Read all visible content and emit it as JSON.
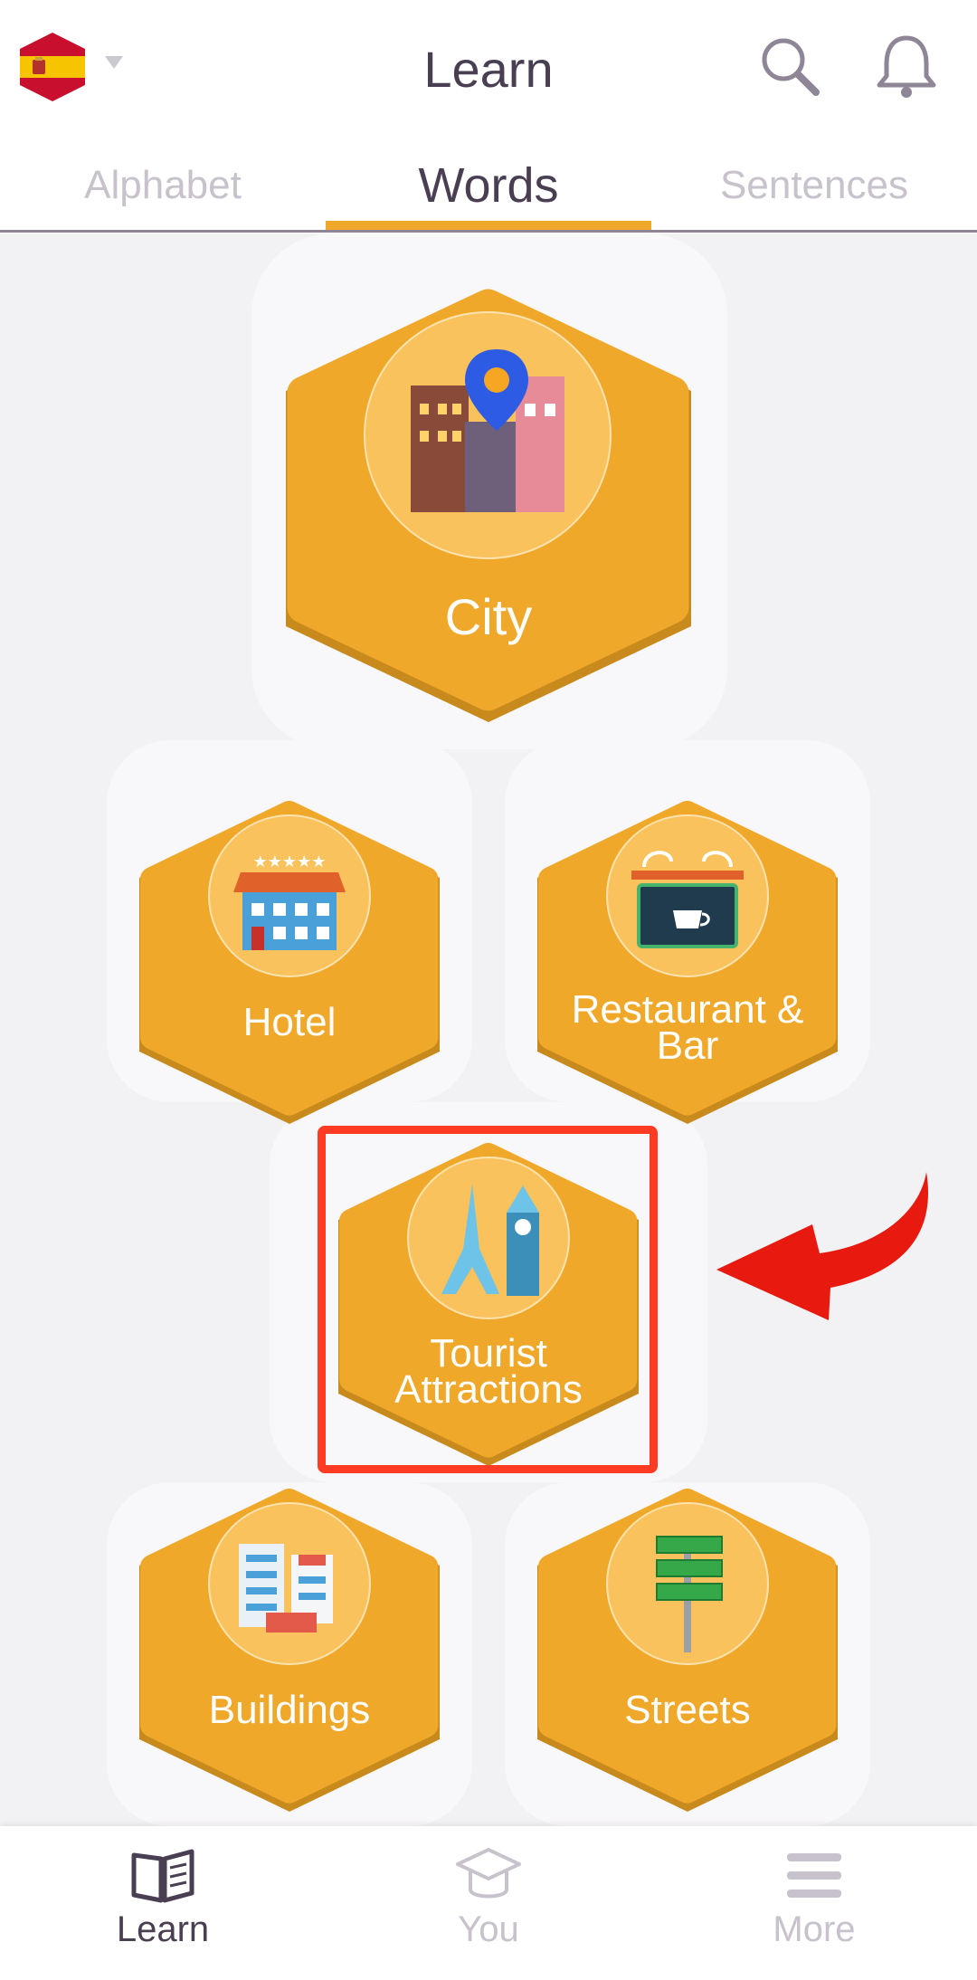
{
  "header": {
    "title": "Learn",
    "language_flag": "spain-flag"
  },
  "tabs": [
    {
      "label": "Alphabet",
      "active": false
    },
    {
      "label": "Words",
      "active": true
    },
    {
      "label": "Sentences",
      "active": false
    }
  ],
  "topics": {
    "city": {
      "label": "City",
      "icon": "city-icon"
    },
    "hotel": {
      "label": "Hotel",
      "icon": "hotel-icon"
    },
    "restaurant": {
      "label": "Restaurant &",
      "label2": "Bar",
      "icon": "cafe-sign-icon"
    },
    "tourist": {
      "label": "Tourist",
      "label2": "Attractions",
      "icon": "eiffel-tower-icon"
    },
    "buildings": {
      "label": "Buildings",
      "icon": "buildings-icon"
    },
    "streets": {
      "label": "Streets",
      "icon": "street-sign-icon"
    }
  },
  "bottom_nav": [
    {
      "label": "Learn",
      "icon": "book-icon",
      "active": true
    },
    {
      "label": "You",
      "icon": "graduation-cap-icon",
      "active": false
    },
    {
      "label": "More",
      "icon": "menu-icon",
      "active": false
    }
  ],
  "colors": {
    "accent": "#f0a82a",
    "highlight": "#ff3b23",
    "text": "#4a3e52",
    "inactive": "#c7c2cb"
  }
}
